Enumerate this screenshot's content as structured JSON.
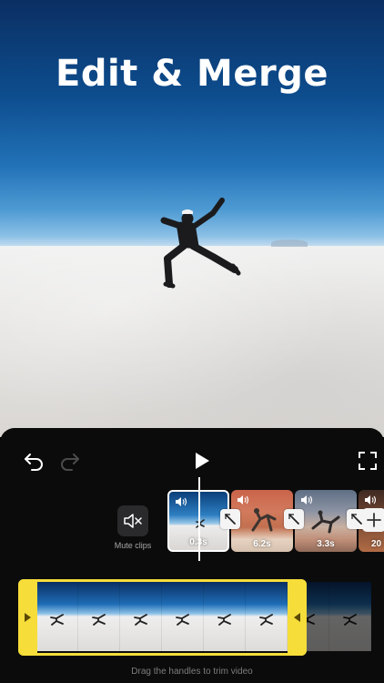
{
  "hero": {
    "title": "Edit & Merge"
  },
  "editor": {
    "mute_label": "Mute clips",
    "clips": [
      {
        "duration": "0.3s",
        "selected": true
      },
      {
        "duration": "6.2s"
      },
      {
        "duration": "3.3s"
      },
      {
        "duration": "20"
      }
    ],
    "trim_hint": "Drag the handles to trim video"
  },
  "colors": {
    "trim_accent": "#f6dd3a",
    "panel_bg": "#0b0b0c",
    "button_bg": "#2a2a2c"
  }
}
